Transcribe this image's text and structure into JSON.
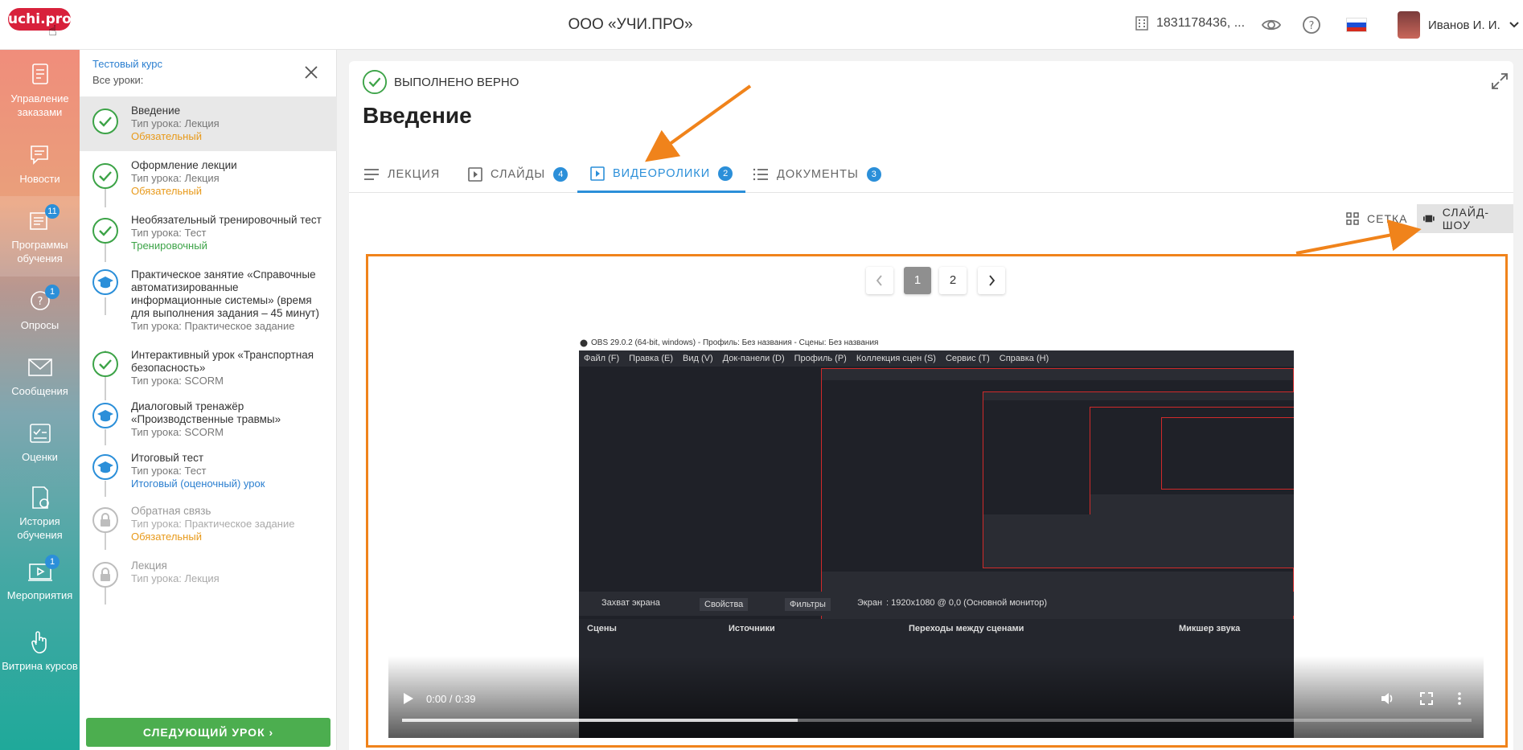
{
  "header": {
    "logo": "uchi.pro",
    "org_name": "ООО «УЧИ.ПРО»",
    "inn": "1831178436, ...",
    "user_name": "Иванов И. И."
  },
  "nav": [
    {
      "label": "Управление заказами",
      "icon": "orders-icon",
      "badge": ""
    },
    {
      "label": "Новости",
      "icon": "news-icon",
      "badge": ""
    },
    {
      "label": "Программы обучения",
      "icon": "programs-icon",
      "badge": "11"
    },
    {
      "label": "Опросы",
      "icon": "surveys-icon",
      "badge": "1"
    },
    {
      "label": "Сообщения",
      "icon": "messages-icon",
      "badge": ""
    },
    {
      "label": "Оценки",
      "icon": "grades-icon",
      "badge": ""
    },
    {
      "label": "История обучения",
      "icon": "history-icon",
      "badge": ""
    },
    {
      "label": "Мероприятия",
      "icon": "events-icon",
      "badge": "1"
    },
    {
      "label": "Витрина курсов",
      "icon": "showcase-icon",
      "badge": ""
    }
  ],
  "lessons_panel": {
    "course": "Тестовый курс",
    "all_lessons": "Все уроки:",
    "next_button": "СЛЕДУЮЩИЙ УРОК  ›",
    "items": [
      {
        "title": "Введение",
        "type": "Тип урока: Лекция",
        "tag": "Обязательный",
        "status": "done"
      },
      {
        "title": "Оформление лекции",
        "type": "Тип урока: Лекция",
        "tag": "Обязательный",
        "status": "done"
      },
      {
        "title": "Необязательный тренировочный тест",
        "type": "Тип урока: Тест",
        "tag": "Тренировочный",
        "status": "done"
      },
      {
        "title": "Практическое занятие «Справочные автоматизированные информационные системы» (время для выполнения задания – 45 минут)",
        "type": "Тип урока: Практическое задание",
        "tag": "",
        "status": "hat"
      },
      {
        "title": "Интерактивный урок «Транспортная безопасность»",
        "type": "Тип урока: SCORM",
        "tag": "",
        "status": "done"
      },
      {
        "title": "Диалоговый тренажёр «Производственные травмы»",
        "type": "Тип урока: SCORM",
        "tag": "",
        "status": "hat"
      },
      {
        "title": "Итоговый тест",
        "type": "Тип урока: Тест",
        "tag": "Итоговый (оценочный) урок",
        "status": "hat"
      },
      {
        "title": "Обратная связь",
        "type": "Тип урока: Практическое задание",
        "tag": "Обязательный",
        "status": "locked"
      },
      {
        "title": "Лекция",
        "type": "Тип урока: Лекция",
        "tag": "",
        "status": "locked"
      }
    ]
  },
  "main": {
    "status": "ВЫПОЛНЕНО ВЕРНО",
    "title": "Введение",
    "tabs": [
      {
        "label": "ЛЕКЦИЯ",
        "count": ""
      },
      {
        "label": "СЛАЙДЫ",
        "count": "4"
      },
      {
        "label": "ВИДЕОРОЛИКИ",
        "count": "2"
      },
      {
        "label": "ДОКУМЕНТЫ",
        "count": "3"
      }
    ],
    "view_grid": "СЕТКА",
    "view_slideshow": "СЛАЙД-ШОУ",
    "pages": [
      "1",
      "2"
    ]
  },
  "video": {
    "obs_title": "OBS 29.0.2 (64-bit, windows) - Профиль: Без названия - Сцены: Без названия",
    "menu": [
      "Файл (F)",
      "Правка (E)",
      "Вид (V)",
      "Док-панели (D)",
      "Профиль (P)",
      "Коллекция сцен (S)",
      "Сервис (T)",
      "Справка (H)"
    ],
    "source": "Захват экрана",
    "properties": "Свойства",
    "filters": "Фильтры",
    "screen_label": "Экран",
    "screen_value": ": 1920x1080 @ 0,0 (Основной монитор)",
    "scenes": "Сцены",
    "sources": "Источники",
    "transitions": "Переходы между сценами",
    "mixer": "Микшер звука",
    "time": "0:00 / 0:39",
    "progress_fraction": 0.37
  }
}
